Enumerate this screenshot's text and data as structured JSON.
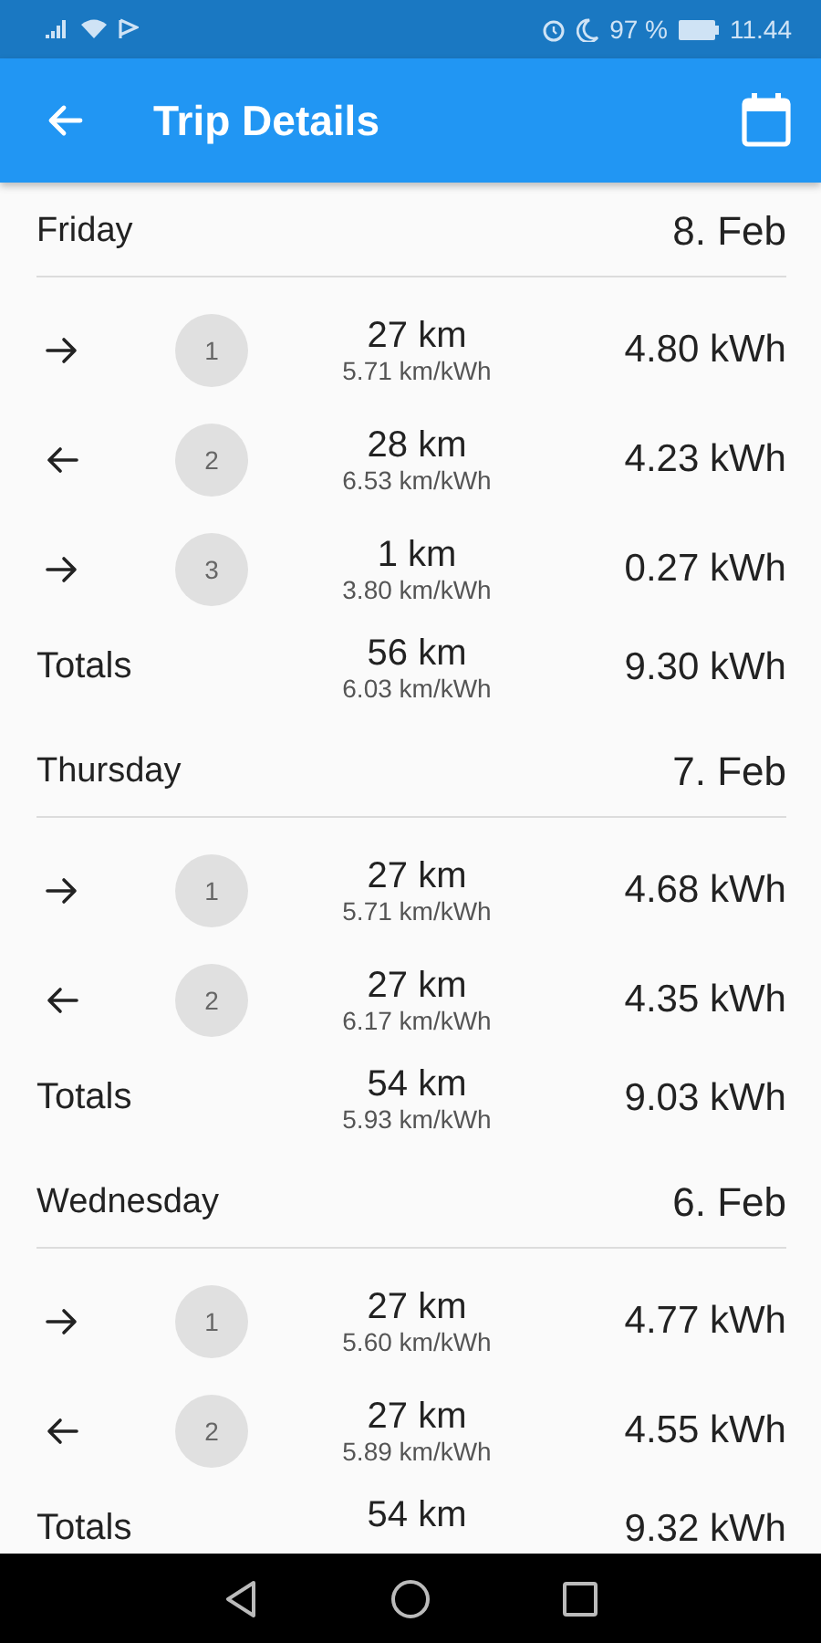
{
  "status_bar": {
    "battery": "97 %",
    "time": "11.44"
  },
  "app_bar": {
    "title": "Trip Details"
  },
  "days": [
    {
      "day": "Friday",
      "date": "8. Feb",
      "trips": [
        {
          "kind": "out",
          "number": "1",
          "distance": "27 km",
          "efficiency": "5.71 km/kWh",
          "energy": "4.80 kWh"
        },
        {
          "kind": "back",
          "number": "2",
          "distance": "28 km",
          "efficiency": "6.53 km/kWh",
          "energy": "4.23 kWh"
        },
        {
          "kind": "out",
          "number": "3",
          "distance": "1 km",
          "efficiency": "3.80 km/kWh",
          "energy": "0.27 kWh"
        }
      ],
      "totals": {
        "label": "Totals",
        "distance": "56 km",
        "efficiency": "6.03 km/kWh",
        "energy": "9.30 kWh"
      }
    },
    {
      "day": "Thursday",
      "date": "7. Feb",
      "trips": [
        {
          "kind": "out",
          "number": "1",
          "distance": "27 km",
          "efficiency": "5.71 km/kWh",
          "energy": "4.68 kWh"
        },
        {
          "kind": "back",
          "number": "2",
          "distance": "27 km",
          "efficiency": "6.17 km/kWh",
          "energy": "4.35 kWh"
        }
      ],
      "totals": {
        "label": "Totals",
        "distance": "54 km",
        "efficiency": "5.93 km/kWh",
        "energy": "9.03 kWh"
      }
    },
    {
      "day": "Wednesday",
      "date": "6. Feb",
      "trips": [
        {
          "kind": "out",
          "number": "1",
          "distance": "27 km",
          "efficiency": "5.60 km/kWh",
          "energy": "4.77 kWh"
        },
        {
          "kind": "back",
          "number": "2",
          "distance": "27 km",
          "efficiency": "5.89 km/kWh",
          "energy": "4.55 kWh"
        }
      ],
      "totals": {
        "label": "Totals",
        "distance": "54 km",
        "energy": "9.32 kWh"
      }
    }
  ]
}
